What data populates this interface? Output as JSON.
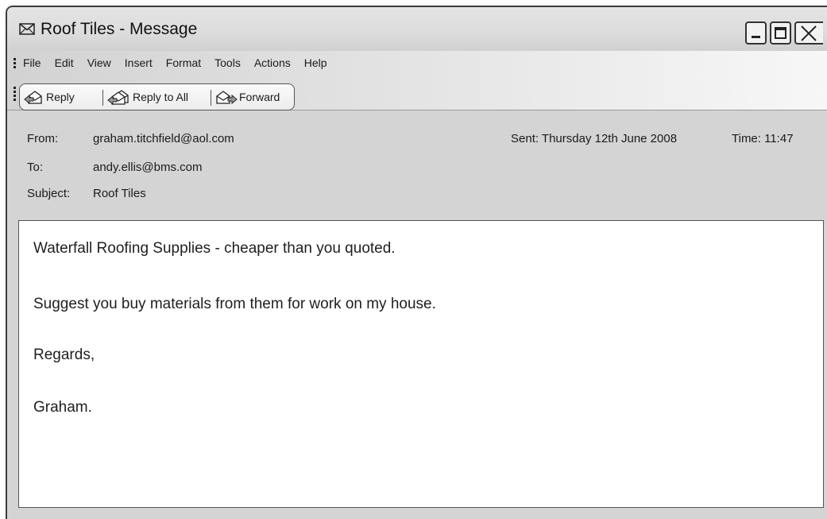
{
  "window": {
    "title": "Roof Tiles - Message",
    "title_icon": "envelope-icon"
  },
  "menu": {
    "items": [
      {
        "label": "File"
      },
      {
        "label": "Edit"
      },
      {
        "label": "View"
      },
      {
        "label": "Insert"
      },
      {
        "label": "Format"
      },
      {
        "label": "Tools"
      },
      {
        "label": "Actions"
      },
      {
        "label": "Help"
      }
    ]
  },
  "toolbar": {
    "reply": "Reply",
    "reply_all": "Reply to All",
    "forward": "Forward"
  },
  "message": {
    "from_label": "From:",
    "from": "graham.titchfield@aol.com",
    "to_label": "To:",
    "to": "andy.ellis@bms.com",
    "subject_label": "Subject:",
    "subject": "Roof Tiles",
    "sent": "Sent: Thursday 12th June 2008",
    "time": "Time: 11:47",
    "body": [
      "Waterfall Roofing Supplies - cheaper than you quoted.",
      "Suggest you buy materials from them for work on my house.",
      "Regards,",
      "Graham."
    ]
  },
  "colors": {
    "chrome": "#d4d4d4",
    "border": "#3c3c3c",
    "body_background": "#ffffff"
  }
}
